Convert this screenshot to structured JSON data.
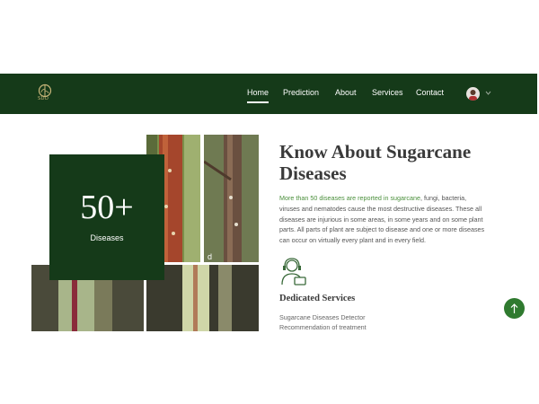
{
  "brand": {
    "logo_text": "SDD"
  },
  "nav": {
    "items": [
      {
        "label": "Home",
        "active": true
      },
      {
        "label": "Prediction",
        "active": false
      },
      {
        "label": "About",
        "active": false
      },
      {
        "label": "Services",
        "active": false
      },
      {
        "label": "Contact",
        "active": false
      }
    ]
  },
  "stats": {
    "number": "50+",
    "label": "Diseases"
  },
  "about": {
    "heading_line1": "Know About Sugarcane",
    "heading_line2": "Diseases",
    "highlight": "More than 50 diseases are reported in sugarcane",
    "body_line1": ", fungi, bacteria,",
    "body_line2": "viruses and nematodes cause the most destructive diseases. These all",
    "body_line3": "diseases are injurious in some areas, in some years and on some plant",
    "body_line4": "parts. All parts of plant are subject to disease and one or more diseases",
    "body_line5": "can occur on virtually every plant and in every field."
  },
  "services": {
    "title": "Dedicated Services",
    "items": [
      "Sugarcane Diseases Detector",
      "Recommendation of treatment"
    ]
  },
  "image_labels": {
    "d": "d"
  },
  "colors": {
    "brand_dark": "#153a19",
    "accent_green": "#4a8f3b",
    "button_green": "#2f7a2f"
  }
}
